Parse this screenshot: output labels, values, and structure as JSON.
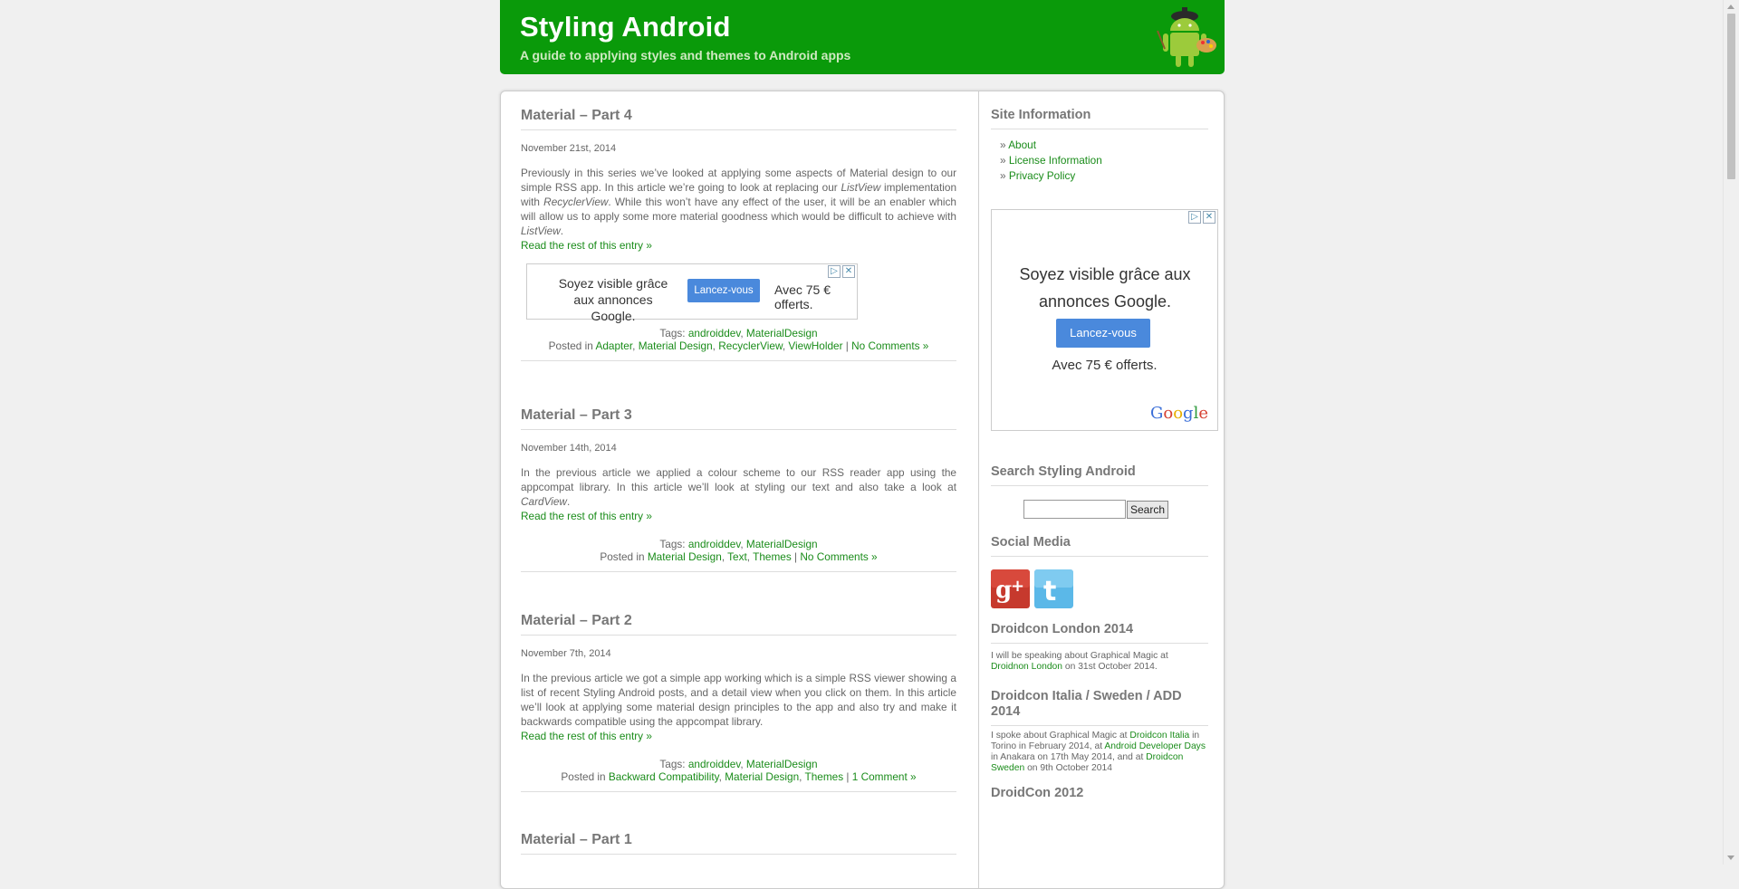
{
  "header": {
    "title": "Styling Android",
    "description": "A guide to applying styles and themes to Android apps"
  },
  "posts": [
    {
      "title": "Material – Part 4",
      "date": "November 21st, 2014",
      "body": [
        {
          "t": "Previously in this series we’ve looked at applying some aspects of Material design to our simple RSS app. In this article we’re going to look at replacing our "
        },
        {
          "t": "ListView",
          "em": true
        },
        {
          "t": " implementation with "
        },
        {
          "t": "RecyclerView",
          "em": true
        },
        {
          "t": ". While this won’t have any effect of the user, it will be an enabler which will allow us to apply some more material goodness which would be difficult to achieve with "
        },
        {
          "t": "ListView",
          "em": true
        },
        {
          "t": "."
        }
      ],
      "read_more": "Read the rest of this entry »",
      "tags_prefix": "Tags:",
      "tags": [
        "androiddev",
        "MaterialDesign"
      ],
      "posted_prefix": "Posted in",
      "categories": [
        "Adapter",
        "Material Design",
        "RecyclerView",
        "ViewHolder"
      ],
      "comments": "No Comments »"
    },
    {
      "title": "Material – Part 3",
      "date": "November 14th, 2014",
      "body": [
        {
          "t": "In the previous article we applied a colour scheme to our RSS reader app using the appcompat library. In this article we’ll look at styling our text and also take a look at "
        },
        {
          "t": "CardView",
          "em": true
        },
        {
          "t": "."
        }
      ],
      "read_more": "Read the rest of this entry »",
      "tags_prefix": "Tags:",
      "tags": [
        "androiddev",
        "MaterialDesign"
      ],
      "posted_prefix": "Posted in",
      "categories": [
        "Material Design",
        "Text",
        "Themes"
      ],
      "comments": "No Comments »"
    },
    {
      "title": "Material – Part 2",
      "date": "November 7th, 2014",
      "body": [
        {
          "t": "In the previous article we got a simple app working which is a simple RSS viewer showing a list of recent Styling Android posts, and a detail view when you click on them. In this article we’ll look at applying some material design principles to the app and also try and make it backwards compatible using the appcompat library."
        }
      ],
      "read_more": "Read the rest of this entry »",
      "tags_prefix": "Tags:",
      "tags": [
        "androiddev",
        "MaterialDesign"
      ],
      "posted_prefix": "Posted in",
      "categories": [
        "Backward Compatibility",
        "Material Design",
        "Themes"
      ],
      "comments": "1 Comment »"
    },
    {
      "title": "Material – Part 1"
    }
  ],
  "inline_ad": {
    "text": "Soyez visible grâce aux annonces Google.",
    "button": "Lancez-vous",
    "offer": "Avec 75 € offerts."
  },
  "sidebar": {
    "site_info_title": "Site Information",
    "site_info_links": [
      "About",
      "License Information",
      "Privacy Policy"
    ],
    "ad": {
      "text": "Soyez visible grâce aux annonces Google.",
      "button": "Lancez-vous",
      "offer": "Avec 75 € offerts.",
      "logo": "Google"
    },
    "search_title": "Search Styling Android",
    "search_button": "Search",
    "search_value": "",
    "social_title": "Social Media",
    "social_icons": [
      "google-plus-icon",
      "twitter-icon"
    ],
    "droidcon_london": {
      "title": "Droidcon London 2014",
      "pre": "I will be speaking about Graphical Magic at ",
      "link": "Droidnon London",
      "post": " on 31st October 2014."
    },
    "droidcon_italia": {
      "title": "Droidcon Italia / Sweden / ADD 2014",
      "p1": "I spoke about Graphical Magic at ",
      "l1": "Droidcon Italia",
      "p2": " in Torino in February 2014, at ",
      "l2": "Android Developer Days",
      "p3": " in Anakara on 17th May 2014, and at ",
      "l3": "Droidcon Sweden",
      "p4": " on 9th October 2014"
    },
    "droidcon_2012_title": "DroidCon 2012"
  },
  "colors": {
    "header_green": "#0a9a0a",
    "link_green": "#1a8c1a",
    "ad_button_blue": "#4a89dc"
  }
}
